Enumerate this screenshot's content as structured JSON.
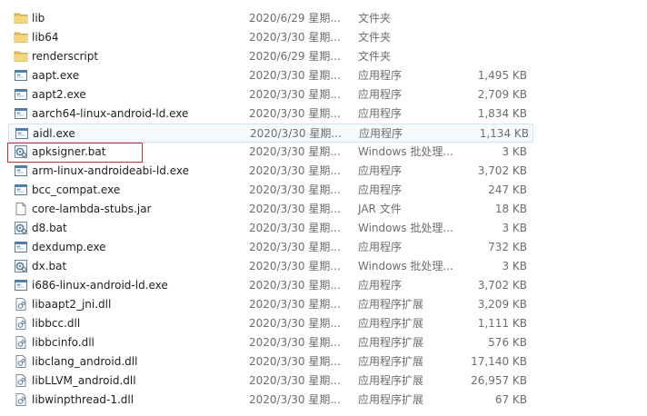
{
  "files": [
    {
      "name": "lib",
      "date": "2020/6/29 星期...",
      "type": "文件夹",
      "size": "",
      "icon": "folder-icon"
    },
    {
      "name": "lib64",
      "date": "2020/3/30 星期...",
      "type": "文件夹",
      "size": "",
      "icon": "folder-icon"
    },
    {
      "name": "renderscript",
      "date": "2020/6/29 星期...",
      "type": "文件夹",
      "size": "",
      "icon": "folder-icon"
    },
    {
      "name": "aapt.exe",
      "date": "2020/3/30 星期...",
      "type": "应用程序",
      "size": "1,495 KB",
      "icon": "exe-icon"
    },
    {
      "name": "aapt2.exe",
      "date": "2020/3/30 星期...",
      "type": "应用程序",
      "size": "2,709 KB",
      "icon": "exe-icon"
    },
    {
      "name": "aarch64-linux-android-ld.exe",
      "date": "2020/3/30 星期...",
      "type": "应用程序",
      "size": "1,834 KB",
      "icon": "exe-icon"
    },
    {
      "name": "aidl.exe",
      "date": "2020/3/30 星期...",
      "type": "应用程序",
      "size": "1,134 KB",
      "icon": "exe-icon"
    },
    {
      "name": "apksigner.bat",
      "date": "2020/3/30 星期...",
      "type": "Windows 批处理...",
      "size": "3 KB",
      "icon": "bat-icon"
    },
    {
      "name": "arm-linux-androideabi-ld.exe",
      "date": "2020/3/30 星期...",
      "type": "应用程序",
      "size": "3,702 KB",
      "icon": "exe-icon"
    },
    {
      "name": "bcc_compat.exe",
      "date": "2020/3/30 星期...",
      "type": "应用程序",
      "size": "247 KB",
      "icon": "exe-icon"
    },
    {
      "name": "core-lambda-stubs.jar",
      "date": "2020/3/30 星期...",
      "type": "JAR 文件",
      "size": "18 KB",
      "icon": "jar-icon"
    },
    {
      "name": "d8.bat",
      "date": "2020/3/30 星期...",
      "type": "Windows 批处理...",
      "size": "3 KB",
      "icon": "bat-icon"
    },
    {
      "name": "dexdump.exe",
      "date": "2020/3/30 星期...",
      "type": "应用程序",
      "size": "732 KB",
      "icon": "exe-icon"
    },
    {
      "name": "dx.bat",
      "date": "2020/3/30 星期...",
      "type": "Windows 批处理...",
      "size": "3 KB",
      "icon": "bat-icon"
    },
    {
      "name": "i686-linux-android-ld.exe",
      "date": "2020/3/30 星期...",
      "type": "应用程序",
      "size": "3,702 KB",
      "icon": "exe-icon"
    },
    {
      "name": "libaapt2_jni.dll",
      "date": "2020/3/30 星期...",
      "type": "应用程序扩展",
      "size": "3,209 KB",
      "icon": "dll-icon"
    },
    {
      "name": "libbcc.dll",
      "date": "2020/3/30 星期...",
      "type": "应用程序扩展",
      "size": "1,111 KB",
      "icon": "dll-icon"
    },
    {
      "name": "libbcinfo.dll",
      "date": "2020/3/30 星期...",
      "type": "应用程序扩展",
      "size": "576 KB",
      "icon": "dll-icon"
    },
    {
      "name": "libclang_android.dll",
      "date": "2020/3/30 星期...",
      "type": "应用程序扩展",
      "size": "17,140 KB",
      "icon": "dll-icon"
    },
    {
      "name": "libLLVM_android.dll",
      "date": "2020/3/30 星期...",
      "type": "应用程序扩展",
      "size": "26,957 KB",
      "icon": "dll-icon"
    },
    {
      "name": "libwinpthread-1.dll",
      "date": "2020/3/30 星期...",
      "type": "应用程序扩展",
      "size": "67 KB",
      "icon": "dll-icon"
    }
  ],
  "colors": {
    "folder": "#e9c15a",
    "hover_border": "#cfe3f8",
    "highlight_box": "#e0272e",
    "secondary_text": "#6d6d6d"
  }
}
